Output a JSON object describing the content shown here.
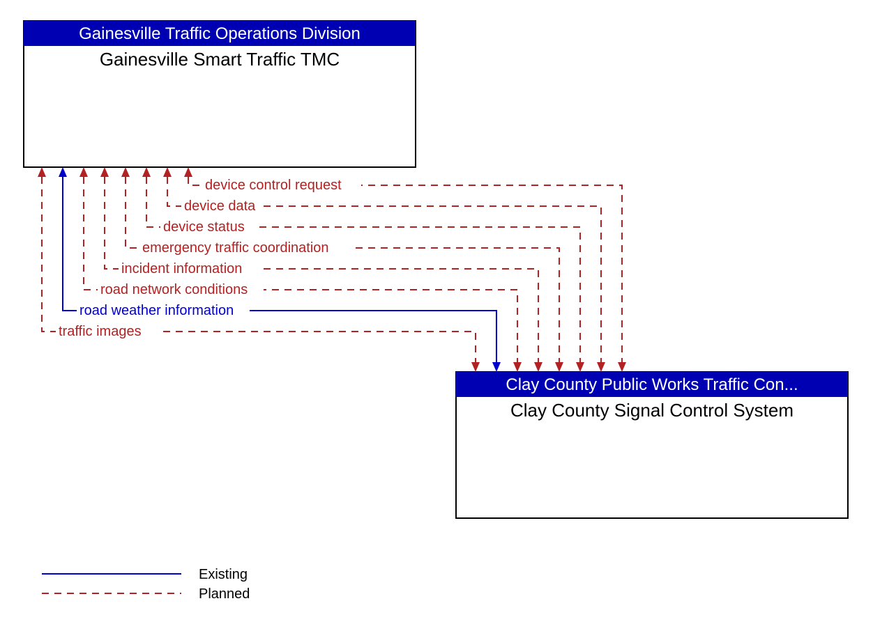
{
  "boxA": {
    "header": "Gainesville Traffic Operations Division",
    "body": "Gainesville Smart Traffic TMC"
  },
  "boxB": {
    "header": "Clay County Public Works Traffic Con...",
    "body": "Clay County Signal Control System"
  },
  "flows": [
    {
      "label": "device control request",
      "status": "planned"
    },
    {
      "label": "device data",
      "status": "planned"
    },
    {
      "label": "device status",
      "status": "planned"
    },
    {
      "label": "emergency traffic coordination",
      "status": "planned"
    },
    {
      "label": "incident information",
      "status": "planned"
    },
    {
      "label": "road network conditions",
      "status": "planned"
    },
    {
      "label": "road weather information",
      "status": "existing"
    },
    {
      "label": "traffic images",
      "status": "planned"
    }
  ],
  "legend": {
    "existing": "Existing",
    "planned": "Planned"
  },
  "chart_data": {
    "type": "diagram",
    "nodes": [
      {
        "id": "A",
        "org": "Gainesville Traffic Operations Division",
        "system": "Gainesville Smart Traffic TMC"
      },
      {
        "id": "B",
        "org": "Clay County Public Works Traffic Control",
        "system": "Clay County Signal Control System"
      }
    ],
    "flows_bidirectional_between": "A<->B",
    "flows": [
      {
        "name": "device control request",
        "status": "planned"
      },
      {
        "name": "device data",
        "status": "planned"
      },
      {
        "name": "device status",
        "status": "planned"
      },
      {
        "name": "emergency traffic coordination",
        "status": "planned"
      },
      {
        "name": "incident information",
        "status": "planned"
      },
      {
        "name": "road network conditions",
        "status": "planned"
      },
      {
        "name": "road weather information",
        "status": "existing"
      },
      {
        "name": "traffic images",
        "status": "planned"
      }
    ],
    "legend": {
      "solid_blue": "Existing",
      "dashed_red": "Planned"
    }
  }
}
